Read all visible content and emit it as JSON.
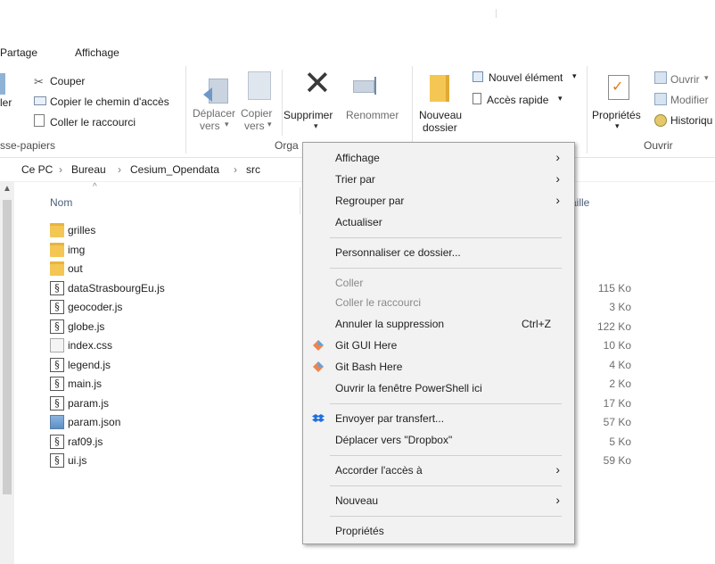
{
  "tabs": {
    "partage": "Partage",
    "affichage": "Affichage"
  },
  "ribbon": {
    "cut": "Couper",
    "copy_path": "Copier le chemin d'accès",
    "paste_shortcut": "Coller le raccourci",
    "paste_partial": "ler",
    "clipboard_group": "sse-papiers",
    "move_to_1": "Déplacer",
    "move_to_2": "vers",
    "copy_to_1": "Copier",
    "copy_to_2": "vers",
    "delete": "Supprimer",
    "rename": "Renommer",
    "organize_group": "Orga",
    "new_folder_1": "Nouveau",
    "new_folder_2": "dossier",
    "new_item": "Nouvel élément",
    "quick_access": "Accès rapide",
    "properties": "Propriétés",
    "open": "Ouvrir",
    "edit": "Modifier",
    "history": "Historiqu",
    "open_group": "Ouvrir"
  },
  "address": {
    "crumbs": [
      "Ce PC",
      "Bureau",
      "Cesium_Opendata",
      "src"
    ]
  },
  "list": {
    "col_name": "Nom",
    "col_size": "aille",
    "files": [
      {
        "name": "grilles",
        "type": "folder",
        "size": ""
      },
      {
        "name": "img",
        "type": "folder",
        "size": ""
      },
      {
        "name": "out",
        "type": "folder",
        "size": ""
      },
      {
        "name": "dataStrasbourgEu.js",
        "type": "js",
        "size": "115 Ko"
      },
      {
        "name": "geocoder.js",
        "type": "js",
        "size": "3 Ko"
      },
      {
        "name": "globe.js",
        "type": "js",
        "size": "122 Ko"
      },
      {
        "name": "index.css",
        "type": "css",
        "size": "10 Ko"
      },
      {
        "name": "legend.js",
        "type": "js",
        "size": "4 Ko"
      },
      {
        "name": "main.js",
        "type": "js",
        "size": "2 Ko"
      },
      {
        "name": "param.js",
        "type": "js",
        "size": "17 Ko"
      },
      {
        "name": "param.json",
        "type": "json",
        "size": "57 Ko"
      },
      {
        "name": "raf09.js",
        "type": "js",
        "size": "5 Ko"
      },
      {
        "name": "ui.js",
        "type": "js",
        "size": "59 Ko"
      }
    ]
  },
  "context_menu": {
    "affichage": "Affichage",
    "trier_par": "Trier par",
    "regrouper_par": "Regrouper par",
    "actualiser": "Actualiser",
    "personnaliser": "Personnaliser ce dossier...",
    "coller": "Coller",
    "coller_raccourci": "Coller le raccourci",
    "annuler_suppression": "Annuler la suppression",
    "annuler_shortcut": "Ctrl+Z",
    "git_gui": "Git GUI Here",
    "git_bash": "Git Bash Here",
    "powershell": "Ouvrir la fenêtre PowerShell ici",
    "envoyer": "Envoyer par transfert...",
    "dropbox": "Déplacer vers \"Dropbox\"",
    "accorder": "Accorder l'accès à",
    "nouveau": "Nouveau",
    "proprietes": "Propriétés"
  }
}
